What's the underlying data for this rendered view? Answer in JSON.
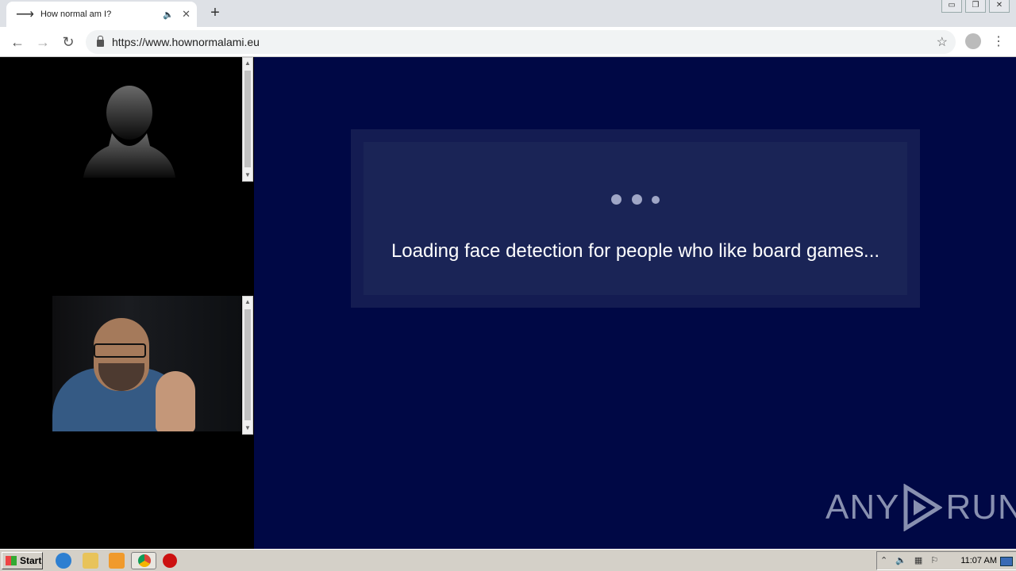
{
  "browser": {
    "tab_title": "How normal am I?",
    "tab_audio_glyph": "🔈",
    "tab_close_glyph": "✕",
    "new_tab_glyph": "+",
    "url": "https://www.hownormalami.eu",
    "window_controls": [
      "▭",
      "❐",
      "✕"
    ]
  },
  "page": {
    "loading_text": "Loading face detection for people who like board games...",
    "watermark": {
      "left": "ANY",
      "right": "RUN"
    },
    "colors": {
      "background": "#000845",
      "card": "#141c52",
      "card_inner": "#1a2456",
      "dots": "#9fa6c6"
    }
  },
  "taskbar": {
    "start_label": "Start",
    "clock": "11:07 AM",
    "apps": [
      "ie-icon",
      "explorer-icon",
      "media-player-icon",
      "chrome-icon",
      "opera-icon"
    ]
  }
}
